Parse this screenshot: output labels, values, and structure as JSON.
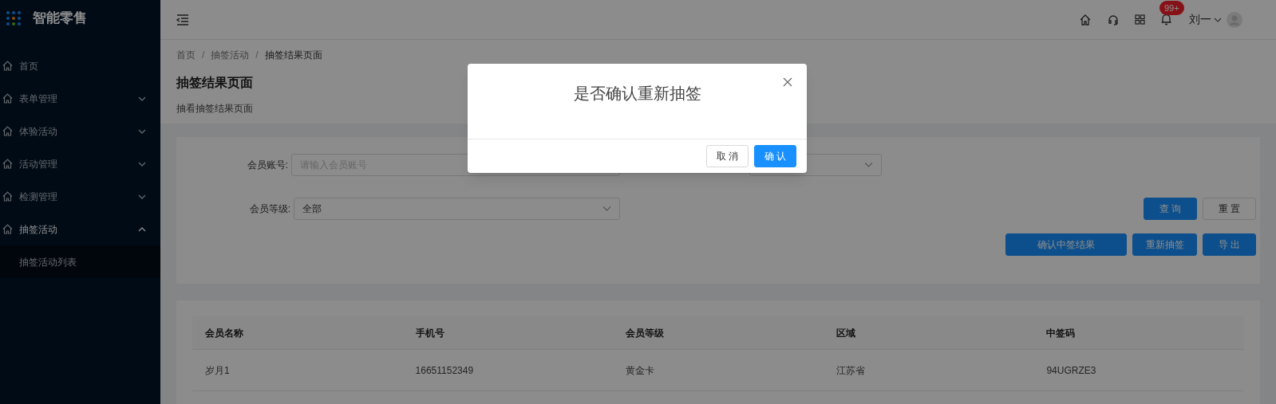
{
  "sidebar": {
    "logo": "智能零售",
    "items": [
      {
        "label": "首页"
      },
      {
        "label": "表单管理",
        "expanded": false
      },
      {
        "label": "体验活动",
        "expanded": false
      },
      {
        "label": "活动管理",
        "expanded": false
      },
      {
        "label": "检测管理",
        "expanded": false
      },
      {
        "label": "抽签活动",
        "expanded": true,
        "children": [
          {
            "label": "抽签活动列表"
          }
        ]
      }
    ]
  },
  "header": {
    "notification_badge": "99+",
    "user": "刘一"
  },
  "breadcrumb": {
    "separator": "/",
    "items": [
      "首页",
      "抽签活动",
      "抽签结果页面"
    ]
  },
  "page_title": "抽签结果页面",
  "page_subtitle": "抽看抽签结果页面",
  "filters": [
    {
      "label": "会员账号:",
      "placeholder": "请输入会员账号"
    },
    {
      "label": "会员等级:",
      "value": "全部"
    }
  ],
  "filter_buttons": [
    {
      "label": "查 询",
      "kind": "primary"
    },
    {
      "label": "重 置",
      "kind": "default"
    }
  ],
  "action_buttons": [
    {
      "label": "确认中签结果",
      "kind": "primary"
    },
    {
      "label": "重新抽签",
      "kind": "primary"
    },
    {
      "label": "导 出",
      "kind": "primary"
    }
  ],
  "table": {
    "columns": [
      "会员名称",
      "手机号",
      "会员等级",
      "区域",
      "中签码"
    ],
    "rows": [
      [
        "岁月1",
        "16651152349",
        "黄金卡",
        "江苏省",
        "94UGRZE3"
      ]
    ]
  },
  "dialog": {
    "title": "是否确认重新抽签",
    "buttons": [
      {
        "label": "取 消",
        "kind": "default"
      },
      {
        "label": "确 认",
        "kind": "primary"
      }
    ]
  }
}
